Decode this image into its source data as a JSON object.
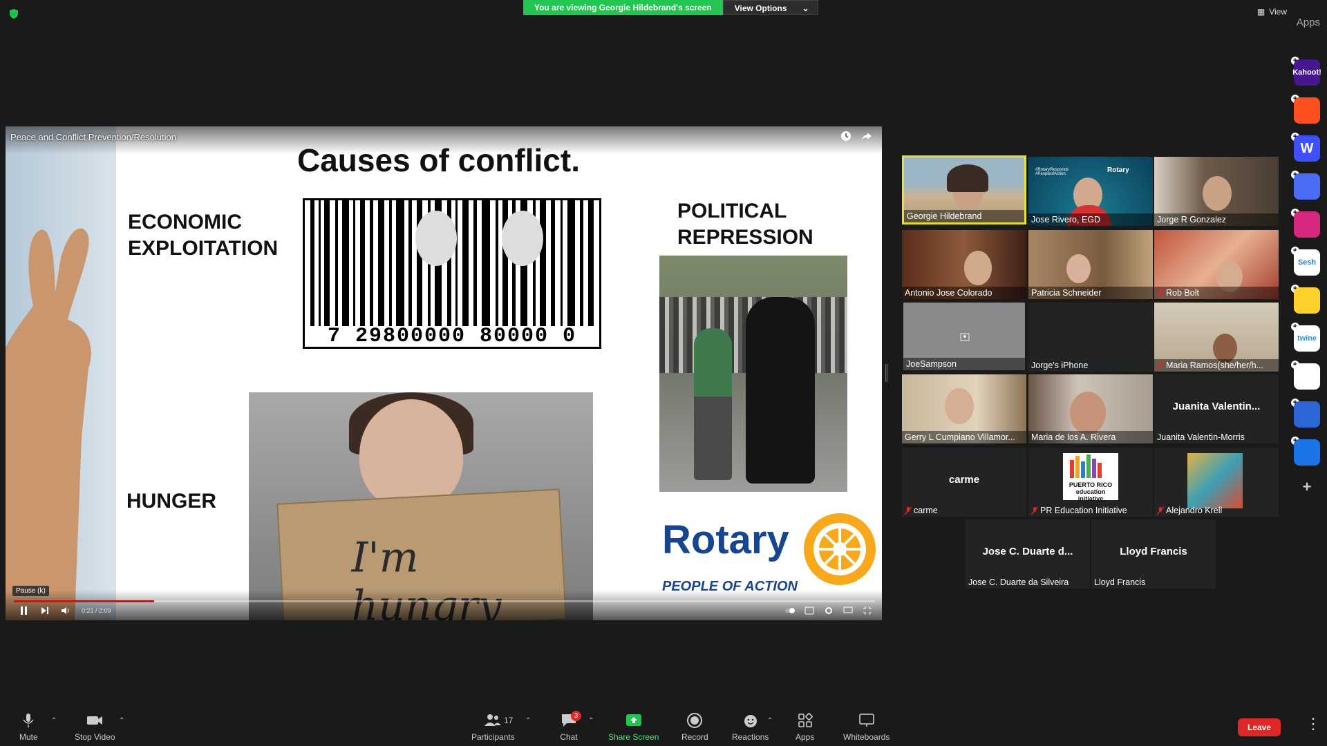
{
  "banner": {
    "viewing_text": "You are viewing Georgie Hildebrand's screen",
    "view_options_label": "View Options"
  },
  "top_right": {
    "view_label": "View",
    "apps_label": "Apps"
  },
  "share": {
    "window_title": "Peace and Conflict Prevention/Resolution",
    "slide": {
      "title": "Causes of conflict.",
      "label_economic_1": "ECONOMIC",
      "label_economic_2": "EXPLOITATION",
      "label_political_1": "POLITICAL",
      "label_political_2": "REPRESSION",
      "label_hunger": "HUNGER",
      "barcode_digits": "7 29800000 80000 0",
      "sign_text": "I'm hungry",
      "rotary_word": "Rotary",
      "rotary_tagline": "PEOPLE OF ACTION",
      "rotary_ring_text": "ROTARY INTERNATIONAL"
    },
    "player": {
      "pause_tooltip": "Pause (k)",
      "time": "0:21 / 2:09",
      "progress_fraction": 0.163
    }
  },
  "participants": [
    {
      "name": "Georgie Hildebrand",
      "muted": false,
      "active": true
    },
    {
      "name": "Jose Rivero, EGD",
      "muted": false
    },
    {
      "name": "Jorge R Gonzalez",
      "muted": false
    },
    {
      "name": "Antonio Jose Colorado",
      "muted": false
    },
    {
      "name": "Patricia Schneider",
      "muted": false
    },
    {
      "name": "Rob Bolt",
      "muted": true
    },
    {
      "name": "JoeSampson",
      "muted": false
    },
    {
      "name": "Jorge's iPhone",
      "muted": false
    },
    {
      "name": "Maria Ramos(she/her/h...",
      "muted": true
    },
    {
      "name": "Gerry L Cumpiano Villamor...",
      "muted": false
    },
    {
      "name": "Maria de los A. Rivera",
      "muted": false
    },
    {
      "name": "Juanita Valentin-Morris",
      "big_name": "Juanita  Valentin...",
      "muted": false
    },
    {
      "name": "carme",
      "big_name": "carme",
      "muted": true
    },
    {
      "name": "PR Education Initiative",
      "muted": true,
      "logo_text": "PUERTO RICO education initiative"
    },
    {
      "name": "Alejandro Krell",
      "muted": true
    },
    {
      "name": "Jose C. Duarte da Silveira",
      "big_name": "Jose C. Duarte d...",
      "muted": false
    },
    {
      "name": "Lloyd Francis",
      "big_name": "Lloyd Francis",
      "muted": false
    }
  ],
  "tile_extra": {
    "rotary_responds": "#RotaryResponds #PeopleofAction",
    "rotary_small": "Rotary"
  },
  "apps_rail": [
    {
      "label": "Kahoot!",
      "color": "#46178f"
    },
    {
      "label": "",
      "color": "#ff4f1f"
    },
    {
      "label": "W",
      "color": "#3f51ff"
    },
    {
      "label": "",
      "color": "#4a6cf7"
    },
    {
      "label": "",
      "color": "#d6287e"
    },
    {
      "label": "Sesh",
      "color": "#ffffff"
    },
    {
      "label": "",
      "color": "#ffd12b"
    },
    {
      "label": "twine",
      "color": "#ffffff"
    },
    {
      "label": "",
      "color": "#ffffff"
    },
    {
      "label": "",
      "color": "#2c67d8"
    },
    {
      "label": "",
      "color": "#1c74e9"
    }
  ],
  "toolbar": {
    "mute": "Mute",
    "stop_video": "Stop Video",
    "participants": "Participants",
    "participants_count": "17",
    "chat": "Chat",
    "chat_badge": "3",
    "share_screen": "Share Screen",
    "record": "Record",
    "reactions": "Reactions",
    "apps": "Apps",
    "whiteboards": "Whiteboards",
    "leave": "Leave"
  },
  "colors": {
    "green": "#23c552",
    "accent_yellow": "#e3e13b",
    "leave_red": "#e02828",
    "rotary_blue": "#17458f"
  }
}
